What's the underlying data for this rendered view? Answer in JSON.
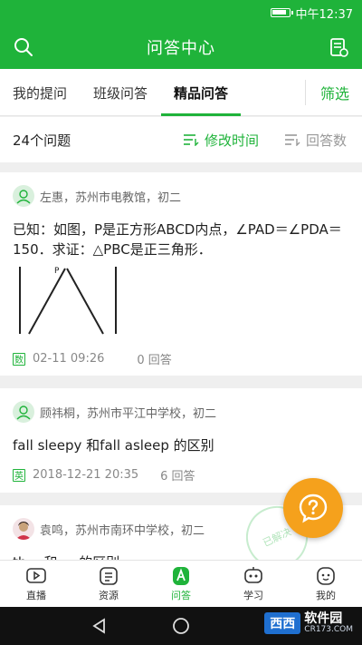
{
  "status": {
    "time": "中午12:37",
    "battery_level": 0.9
  },
  "header": {
    "title": "问答中心",
    "left_icon": "search-icon",
    "right_icon": "notes-icon"
  },
  "tabs": [
    {
      "label": "我的提问",
      "active": false
    },
    {
      "label": "班级问答",
      "active": false
    },
    {
      "label": "精品问答",
      "active": true
    }
  ],
  "filter_label": "筛选",
  "sortbar": {
    "count_label": "24个问题",
    "sort_options": [
      {
        "label": "修改时间",
        "active": true
      },
      {
        "label": "回答数",
        "active": false
      }
    ]
  },
  "questions": [
    {
      "author": "左惠，苏州市电教馆，初二",
      "text": "已知：如图，P是正方形ABCD内点，∠PAD＝∠PDA＝150．求证：△PBC是正三角形．",
      "subject": "数",
      "date": "02-11 09:26",
      "answers": "0 回答",
      "figure_label": "P"
    },
    {
      "author": "顾祎桐，苏州市平江中学校，初二",
      "text": "fall sleepy 和fall asleep 的区别",
      "subject": "英",
      "date": "2018-12-21 20:35",
      "answers": "6 回答"
    },
    {
      "author": "袁鸣，苏州市南环中学校，初二",
      "text": "th... 和 ... 的区别"
    }
  ],
  "stamp_text": "已解决",
  "fab_icon": "question-icon",
  "bottom_nav": [
    {
      "label": "直播",
      "icon": "live-icon",
      "active": false
    },
    {
      "label": "资源",
      "icon": "resource-icon",
      "active": false
    },
    {
      "label": "问答",
      "icon": "qa-icon",
      "active": true
    },
    {
      "label": "学习",
      "icon": "study-icon",
      "active": false
    },
    {
      "label": "我的",
      "icon": "profile-icon",
      "active": false
    }
  ],
  "watermark": {
    "badge": "西西",
    "text": "软件园",
    "sub": "CR173.COM"
  },
  "colors": {
    "brand": "#1fb33a",
    "fab": "#f5a11c"
  }
}
